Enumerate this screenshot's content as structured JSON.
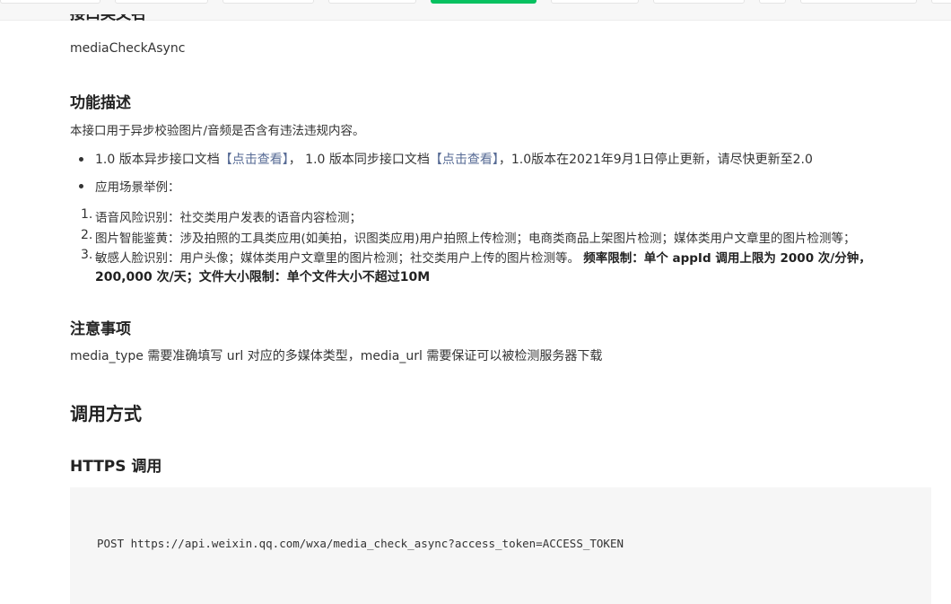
{
  "interface_name": {
    "heading": "接口英文名",
    "value": "mediaCheckAsync"
  },
  "description": {
    "heading": "功能描述",
    "intro": "本接口用于异步校验图片/音频是否含有违法违规内容。",
    "bullet1": {
      "part1": "1.0 版本异步接口文档",
      "link1": "【点击查看】",
      "part2": "， 1.0 版本同步接口文档",
      "link2": "【点击查看】",
      "part3": "，1.0版本在2021年9月1日停止更新，请尽快更新至2.0"
    },
    "bullet2": "应用场景举例：",
    "items": [
      {
        "num": "1.",
        "text": "语音风险识别：社交类用户发表的语音内容检测；"
      },
      {
        "num": "2.",
        "text": "图片智能鉴黄：涉及拍照的工具类应用(如美拍，识图类应用)用户拍照上传检测；电商类商品上架图片检测；媒体类用户文章里的图片检测等；"
      },
      {
        "num": "3.",
        "text": "敏感人脸识别：用户头像；媒体类用户文章里的图片检测；社交类用户上传的图片检测等。",
        "bold_line1": "频率限制：单个 appId 调用上限为 2000 次/分钟，",
        "bold_line2": "200,000 次/天；文件大小限制：单个文件大小不超过10M"
      }
    ]
  },
  "notes": {
    "heading": "注意事项",
    "text": "media_type 需要准确填写 url 对应的多媒体类型，media_url 需要保证可以被检测服务器下载"
  },
  "invocation": {
    "heading": "调用方式",
    "https_heading": "HTTPS 调用",
    "code": "POST https://api.weixin.qq.com/wxa/media_check_async?access_token=ACCESS_TOKEN"
  }
}
